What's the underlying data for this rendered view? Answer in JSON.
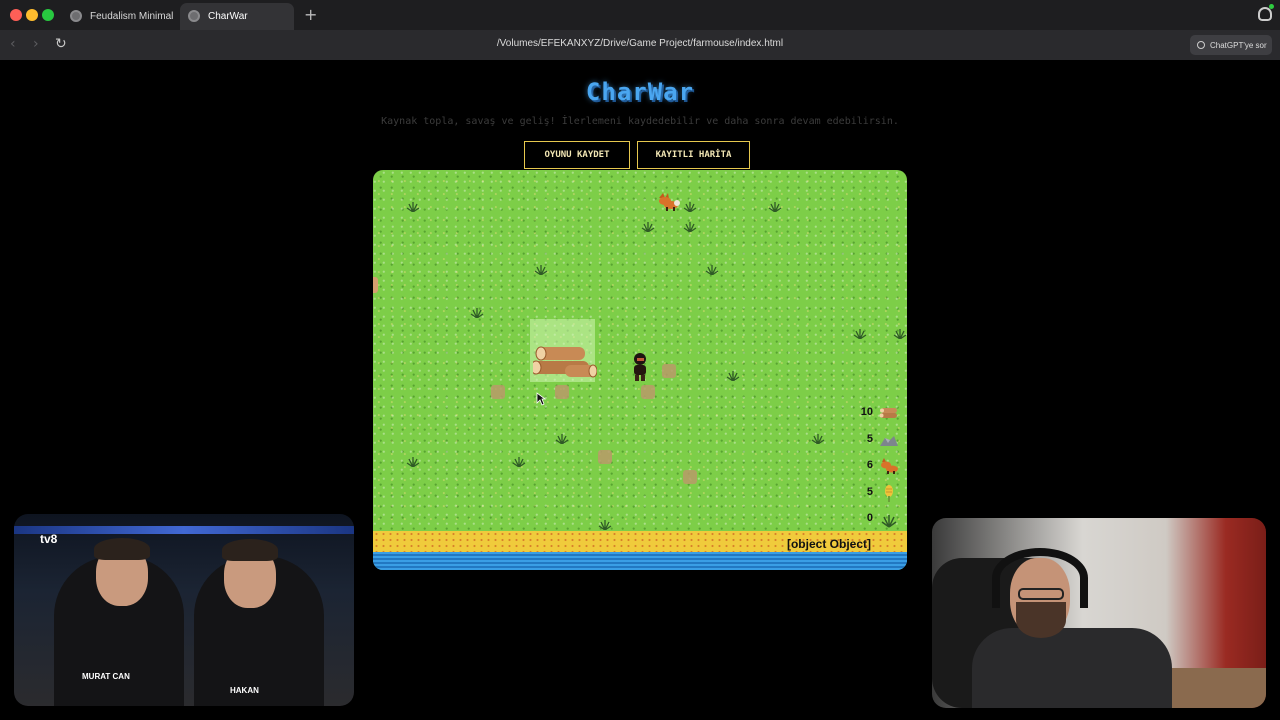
{
  "browser": {
    "tabs": [
      {
        "label": "Feudalism Minimal",
        "active": false
      },
      {
        "label": "CharWar",
        "active": true
      }
    ],
    "new_tab_label": "+",
    "url": "/Volumes/EFEKANXYZ/Drive/Game Project/farmouse/index.html",
    "chatgpt_button": "ChatGPT'ye sor",
    "traffic_colors": [
      "#fe5f57",
      "#febc2e",
      "#28c840"
    ]
  },
  "page": {
    "title": "CharWar",
    "subtitle": "Kaynak topla, savaş ve geliş! İlerlemeni kaydedebilir ve daha sonra devam edebilirsin.",
    "buttons": {
      "save": "OYUNU KAYDET",
      "load": "KAYITLI HARİTA"
    },
    "title_color": "#4aa6f0",
    "button_border_color": "#e6c84e"
  },
  "game": {
    "status_text": "[object Object]",
    "inventory": [
      {
        "count": "10",
        "icon": "wood-log-icon"
      },
      {
        "count": "5",
        "icon": "stone-icon"
      },
      {
        "count": "6",
        "icon": "fox-fur-icon"
      },
      {
        "count": "5",
        "icon": "wheat-icon"
      },
      {
        "count": "0",
        "icon": "grass-tuft-icon"
      }
    ],
    "terrain_colors": {
      "grass": "#7dce48",
      "sand": "#f0cb3c",
      "water": "#2f8fd8"
    }
  },
  "webcams": {
    "left": {
      "channel_logo": "tv8",
      "name_tags": [
        "MURAT CAN",
        "HAKAN"
      ]
    },
    "right": {}
  }
}
